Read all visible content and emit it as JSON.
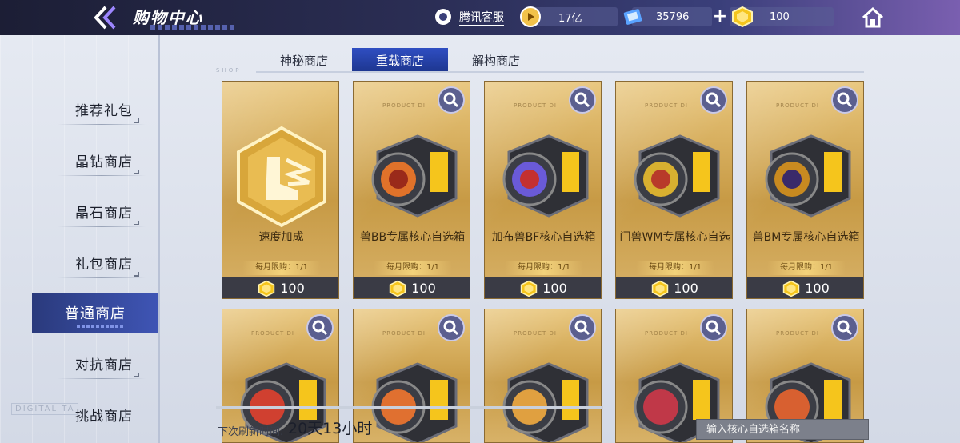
{
  "header": {
    "title": "购物中心",
    "customer_service": "腾讯客服",
    "resources": [
      {
        "icon": "play-coin-icon",
        "value": "17亿"
      },
      {
        "icon": "crystal-icon",
        "value": "35796"
      },
      {
        "icon": "gem-icon",
        "value": "100"
      }
    ]
  },
  "sidebar": {
    "items": [
      {
        "label": "推荐礼包"
      },
      {
        "label": "晶钻商店"
      },
      {
        "label": "晶石商店"
      },
      {
        "label": "礼包商店"
      },
      {
        "label": "普通商店",
        "active": true
      },
      {
        "label": "对抗商店"
      },
      {
        "label": "挑战商店"
      }
    ],
    "watermark": "DIGITAL TA"
  },
  "tabs": [
    {
      "label": "神秘商店"
    },
    {
      "label": "重载商店",
      "active": true
    },
    {
      "label": "解构商店"
    }
  ],
  "shop_tag": "SHOP",
  "cards": [
    {
      "name": "速度加成",
      "limit": "每月限购：1/1",
      "price": "100",
      "icon": "boot-speed-icon"
    },
    {
      "name": "兽BB专属核心自选箱",
      "limit": "每月限购：1/1",
      "price": "100",
      "icon": "core-capsule-icon"
    },
    {
      "name": "加布兽BF核心自选箱",
      "limit": "每月限购：1/1",
      "price": "100",
      "icon": "core-capsule-icon"
    },
    {
      "name": "门兽WM专属核心自选",
      "limit": "每月限购：1/1",
      "price": "100",
      "icon": "core-capsule-icon"
    },
    {
      "name": "兽BM专属核心自选箱",
      "limit": "每月限购：1/1",
      "price": "100",
      "icon": "core-capsule-icon"
    }
  ],
  "card_brand": "PRODUCT DI",
  "footer": {
    "refresh_label": "下次刷新时间:",
    "refresh_value": "20天13小时",
    "search_placeholder": "输入核心自选箱名称"
  },
  "colors": {
    "accent": "#2f4ec2",
    "card_gold": "#e8c57a",
    "price_bar": "#3a3b45"
  }
}
